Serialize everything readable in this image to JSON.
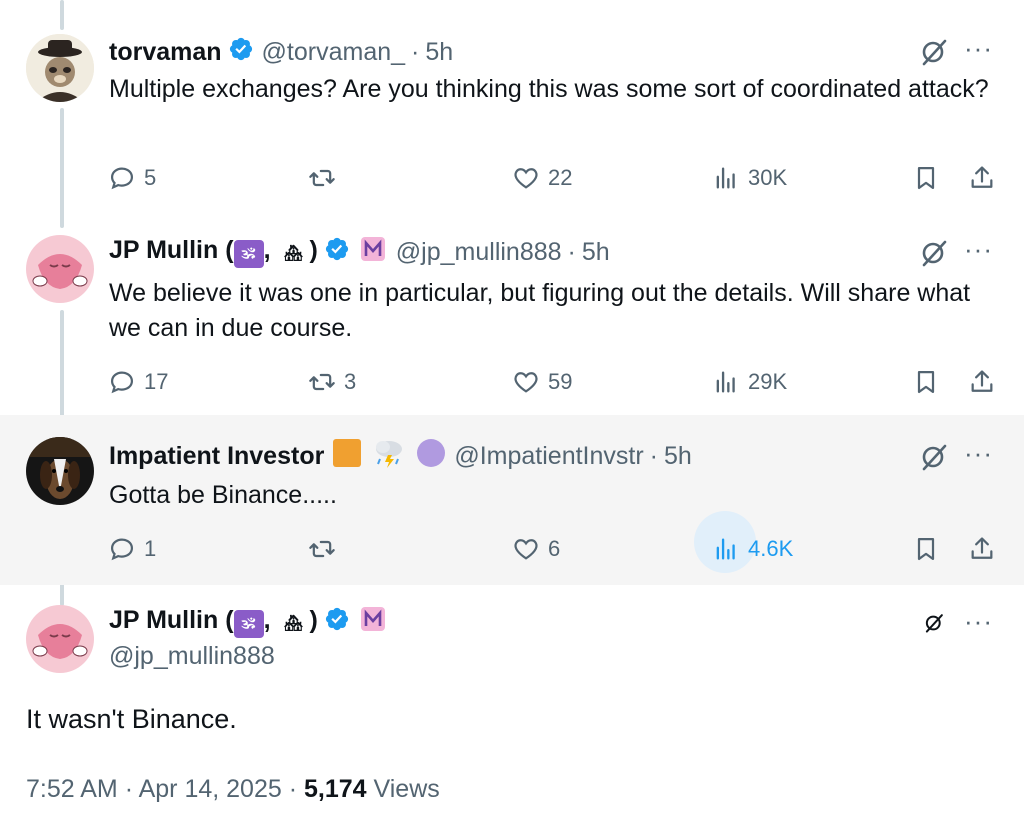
{
  "tweets": [
    {
      "name": "torvaman",
      "handle": "@torvaman_",
      "time": "5h",
      "text": "Multiple exchanges? Are you thinking this was some sort of coordinated attack?",
      "replies": "5",
      "reposts": "",
      "likes": "22",
      "views": "30K"
    },
    {
      "name": "JP Mullin",
      "name_emoji_1": "🕉",
      "name_emoji_2": "🏘",
      "handle": "@jp_mullin888",
      "time": "5h",
      "text": "We believe it was one in particular, but figuring out the details. Will share what we can in due course.",
      "replies": "17",
      "reposts": "3",
      "likes": "59",
      "views": "29K"
    },
    {
      "name": "Impatient Investor",
      "handle": "@ImpatientInvstr",
      "time": "5h",
      "text": "Gotta be Binance.....",
      "replies": "1",
      "reposts": "",
      "likes": "6",
      "views": "4.6K"
    }
  ],
  "main_tweet": {
    "name": "JP Mullin",
    "name_emoji_1": "🕉",
    "name_emoji_2": "🏘",
    "handle": "@jp_mullin888",
    "text": "It wasn't Binance.",
    "time": "7:52 AM",
    "date": "Apr 14, 2025",
    "views_count": "5,174",
    "views_label": "Views"
  },
  "colors": {
    "verified": "#1d9bf0",
    "muted": "#536471",
    "accent": "#1d9bf0",
    "highlight_bg": "#f5f5f5",
    "orange_badge": "#f0a030",
    "purple_badge": "#b09ae0"
  },
  "icons": [
    "reply-icon",
    "repost-icon",
    "like-icon",
    "views-icon",
    "bookmark-icon",
    "share-icon",
    "grok-icon",
    "more-icon",
    "verified-icon"
  ]
}
